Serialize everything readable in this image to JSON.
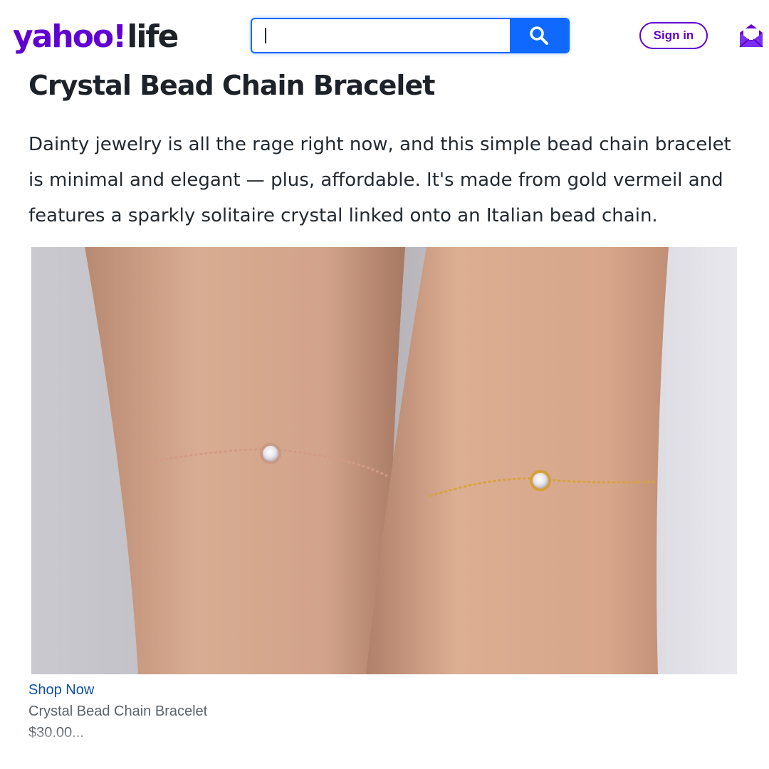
{
  "header": {
    "logo_yahoo": "yahoo!",
    "logo_life": "life",
    "search": {
      "value": "",
      "placeholder": ""
    },
    "signin_label": "Sign in",
    "brand_color": "#6001d2",
    "search_color": "#0f69ff"
  },
  "article": {
    "title": "Crystal Bead Chain Bracelet",
    "body": "Dainty jewelry is all the rage right now, and this simple bead chain bracelet is minimal and elegant — plus, affordable. It's made from gold vermeil and features a sparkly solitaire crystal linked onto an Italian bead chain.",
    "image_alt": "two-wrists-rose-and-gold-bracelets"
  },
  "product": {
    "cta": "Shop Now",
    "name": "Crystal Bead Chain Bracelet",
    "price": "$30.00..."
  }
}
